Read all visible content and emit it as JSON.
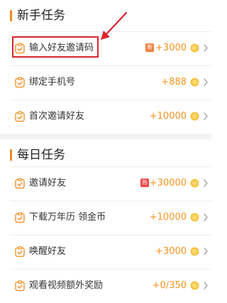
{
  "sections": [
    {
      "title": "新手任务",
      "tasks": [
        {
          "label": "输入好友邀请码",
          "badge": "新",
          "badge_color": "#f07f3c",
          "reward": "+3000"
        },
        {
          "label": "绑定手机号",
          "reward": "+888"
        },
        {
          "label": "首次邀请好友",
          "reward": "+10000"
        }
      ]
    },
    {
      "title": "每日任务",
      "tasks": [
        {
          "label": "邀请好友",
          "badge": "热",
          "badge_color": "#ec4848",
          "reward": "+30000"
        },
        {
          "label": "下载万年历 领金币",
          "reward": "+10000"
        },
        {
          "label": "唤醒好友",
          "reward": "+3000"
        },
        {
          "label": "观看视频额外奖励",
          "reward": "+0/350"
        }
      ]
    }
  ],
  "colors": {
    "accent": "#f08a1c",
    "reward_text": "#f7931e",
    "coin": "#f6c344",
    "annotation": "#d9252a",
    "divider_band": "#f2f2f2"
  },
  "icons": {
    "task": "clipboard-check-icon",
    "coin": "gold-coin-icon",
    "chevron": "chevron-right-icon",
    "annotation": "red-arrow-annotation"
  }
}
